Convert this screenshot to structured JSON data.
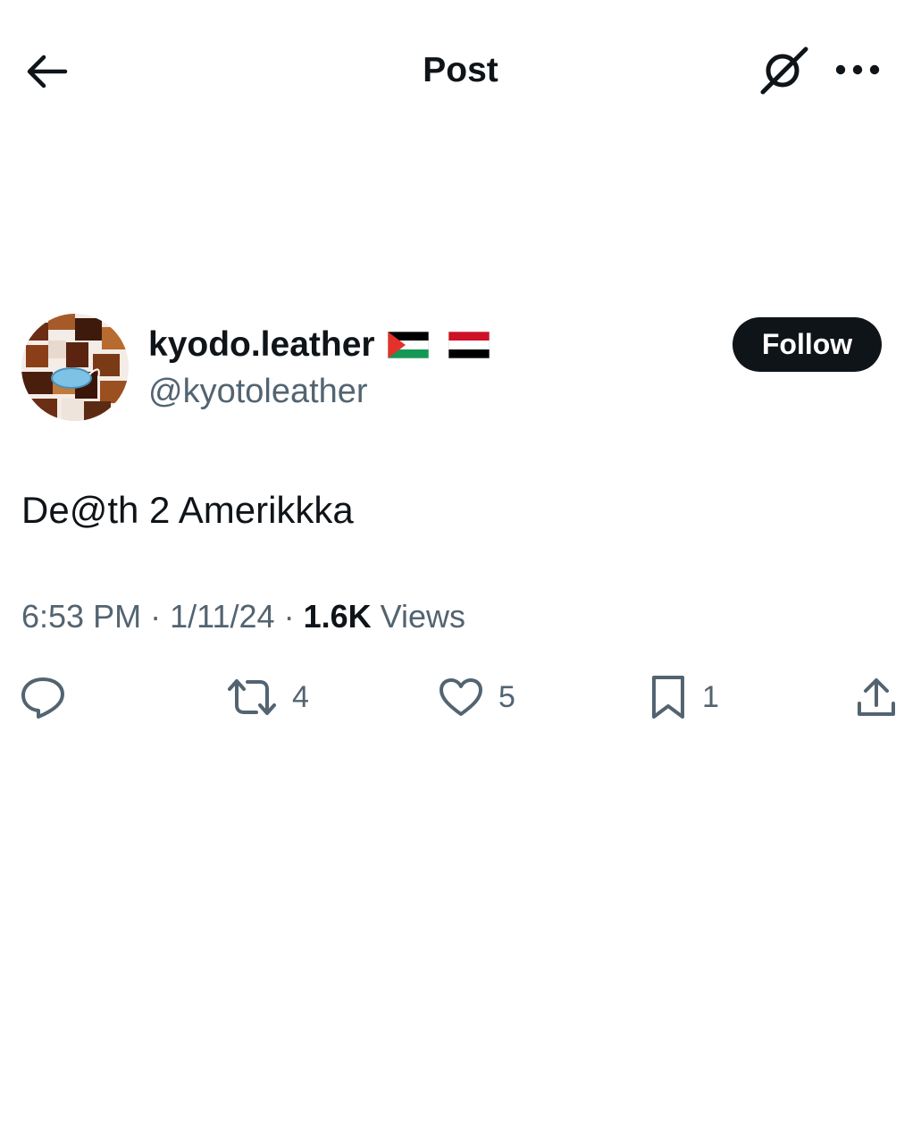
{
  "header": {
    "title": "Post",
    "back_icon": "arrow-left-icon",
    "grok_icon": "grok-icon",
    "more_icon": "more-horizontal-icon"
  },
  "author": {
    "display_name": "kyodo.leather",
    "flags": [
      "palestine-flag",
      "yemen-flag"
    ],
    "handle": "@kyotoleather",
    "follow_label": "Follow"
  },
  "post": {
    "text": "De@th 2 Amerikkka"
  },
  "meta": {
    "time": "6:53 PM",
    "separator": "·",
    "date": "1/11/24",
    "views_count": "1.6K",
    "views_label": "Views"
  },
  "actions": {
    "reply": {
      "icon": "reply-icon",
      "count": ""
    },
    "repost": {
      "icon": "repost-icon",
      "count": "4"
    },
    "like": {
      "icon": "heart-icon",
      "count": "5"
    },
    "bookmark": {
      "icon": "bookmark-icon",
      "count": "1"
    },
    "share": {
      "icon": "share-icon",
      "count": ""
    }
  },
  "colors": {
    "text_primary": "#0f1419",
    "text_secondary": "#536471",
    "follow_bg": "#0f1419",
    "follow_text": "#ffffff",
    "background": "#ffffff"
  }
}
